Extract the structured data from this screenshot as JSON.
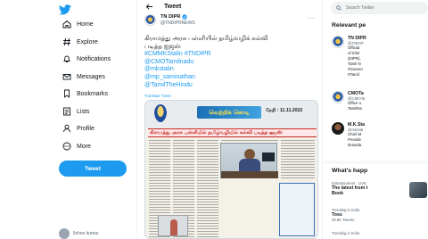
{
  "brand": {
    "accent": "#1d9bf0",
    "text": "#0f1419",
    "muted": "#536471"
  },
  "sidebar": {
    "logo_icon": "twitter-bird-icon",
    "items": [
      {
        "label": "Home",
        "icon": "home-icon"
      },
      {
        "label": "Explore",
        "icon": "hashtag-icon"
      },
      {
        "label": "Notifications",
        "icon": "bell-icon"
      },
      {
        "label": "Messages",
        "icon": "envelope-icon"
      },
      {
        "label": "Bookmarks",
        "icon": "bookmark-icon"
      },
      {
        "label": "Lists",
        "icon": "list-icon"
      },
      {
        "label": "Profile",
        "icon": "person-icon"
      },
      {
        "label": "More",
        "icon": "more-circle-icon"
      }
    ],
    "tweet_button": "Tweet",
    "account_name": "Ilshon kumar"
  },
  "main": {
    "header_title": "Tweet",
    "author": {
      "name": "TN DIPR",
      "handle": "@TNDIPRNEWS"
    },
    "tweet_lines": [
      "கிராமத்து அரசு பள்ளியில் தமிழ்வழிக் கல்வி",
      "படித்த ஐஜஸ்"
    ],
    "hashtags": "#CMMKStalin #TNDIPR",
    "mentions": [
      "@CMOTamilnadu",
      "@mkstalin",
      "@mp_saminathan",
      "@TamilTheHindu"
    ],
    "translate": "Translate Tweet",
    "clip": {
      "banner": "வெற்றிக் கொடி",
      "date": "தேதி : 11.11.2022",
      "headline": "கிராமத்து அரசு பள்ளியில் தமிழ்வழியில் கல்வி படித்த ஐஜஸ்"
    }
  },
  "right": {
    "search_placeholder": "Search Twitter",
    "relevant_title": "Relevant pe",
    "people": [
      {
        "name": "TN DIPR",
        "handle": "@TNDIP",
        "bio": [
          "Official",
          "of Infor",
          "(DIPR),",
          "Tamil N",
          "#Govern",
          "#Tamil"
        ]
      },
      {
        "name": "CMOTa",
        "handle": "@CMOTa",
        "bio": [
          "Office o",
          "TamilNa"
        ]
      },
      {
        "name": "M.K.Sta",
        "handle": "@mkstal",
        "bio": [
          "Chief M",
          "Preside",
          "Dravida"
        ]
      }
    ],
    "whats_title": "What's happ",
    "trends": [
      {
        "meta": "Entertainment · LIVE",
        "name": "The latest from t",
        "extra": "Book"
      },
      {
        "meta": "Trending in India",
        "name": "Toss",
        "count": "28.6K Tweets"
      },
      {
        "meta": "Trending in India",
        "name": "",
        "count": ""
      }
    ]
  }
}
